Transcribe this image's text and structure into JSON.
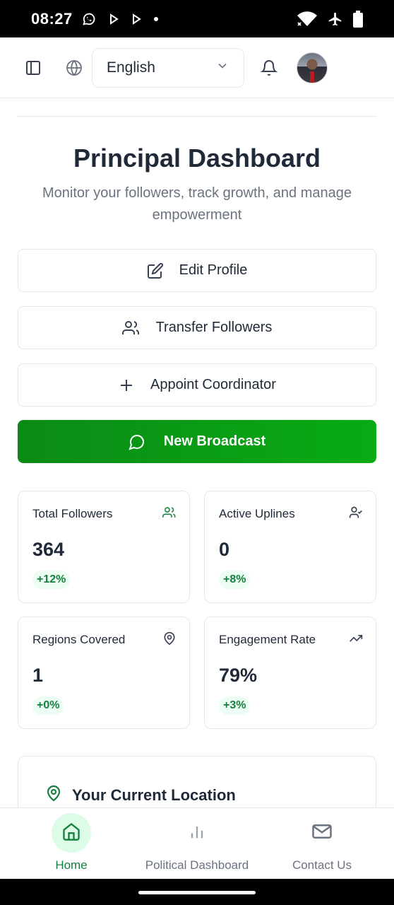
{
  "status_bar": {
    "time": "08:27"
  },
  "header": {
    "language": "English"
  },
  "page": {
    "title": "Principal Dashboard",
    "subtitle": "Monitor your followers, track growth, and manage empowerment"
  },
  "actions": {
    "edit_profile": "Edit Profile",
    "transfer_followers": "Transfer Followers",
    "appoint_coordinator": "Appoint Coordinator",
    "new_broadcast": "New Broadcast"
  },
  "stats": [
    {
      "label": "Total Followers",
      "value": "364",
      "change": "+12%",
      "icon": "users-icon",
      "icon_color": "#15803d"
    },
    {
      "label": "Active Uplines",
      "value": "0",
      "change": "+8%",
      "icon": "user-check-icon",
      "icon_color": "#374151"
    },
    {
      "label": "Regions Covered",
      "value": "1",
      "change": "+0%",
      "icon": "map-pin-icon",
      "icon_color": "#374151"
    },
    {
      "label": "Engagement Rate",
      "value": "79%",
      "change": "+3%",
      "icon": "trending-up-icon",
      "icon_color": "#374151"
    }
  ],
  "location": {
    "title": "Your Current Location"
  },
  "bottom_nav": [
    {
      "label": "Home",
      "active": true,
      "icon": "home-icon"
    },
    {
      "label": "Political Dashboard",
      "active": false,
      "icon": "bar-chart-icon"
    },
    {
      "label": "Contact Us",
      "active": false,
      "icon": "mail-icon"
    }
  ],
  "colors": {
    "primary_green": "#0b8a16",
    "badge_green_text": "#15803d",
    "badge_green_bg": "#ecfdf3"
  }
}
